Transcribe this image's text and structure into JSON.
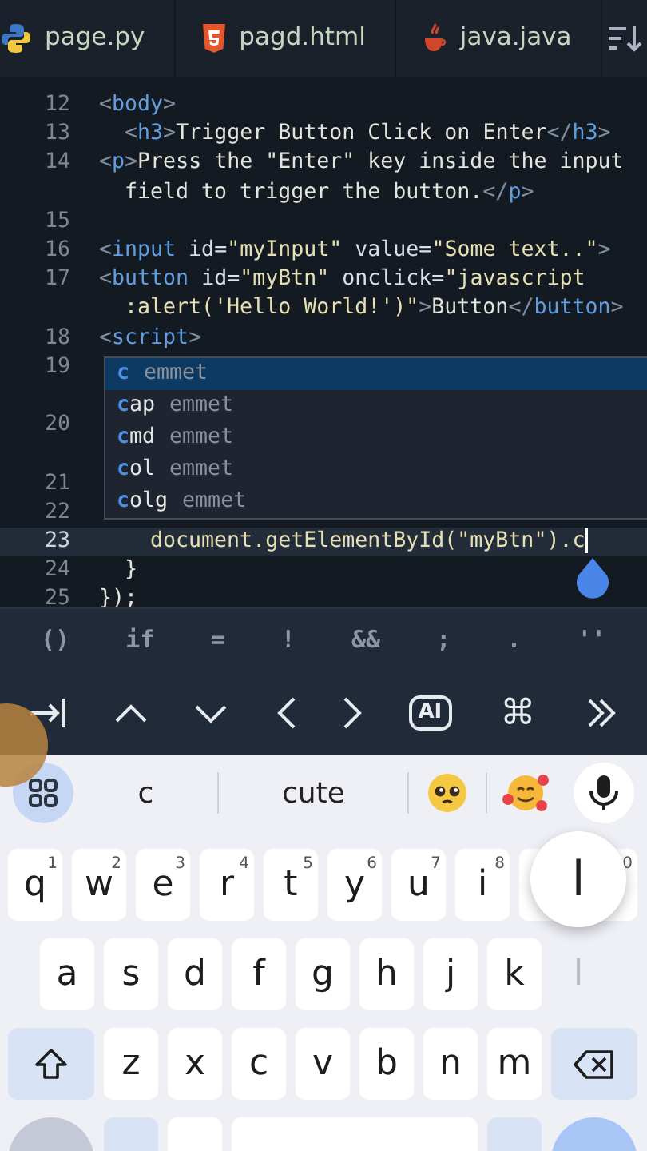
{
  "tabs": [
    {
      "label": "page.py",
      "kind": "python"
    },
    {
      "label": "pagd.html",
      "kind": "html"
    },
    {
      "label": "java.java",
      "kind": "java"
    }
  ],
  "editor": {
    "lines": [
      {
        "kind": "line",
        "number": "12",
        "current": false,
        "segments": [
          {
            "t": "<",
            "kind": "p"
          },
          {
            "t": "body",
            "kind": "tag"
          },
          {
            "t": ">",
            "kind": "p"
          }
        ]
      },
      {
        "kind": "line",
        "number": "13",
        "current": false,
        "segments": [
          {
            "t": "  <",
            "kind": "p"
          },
          {
            "t": "h3",
            "kind": "tag"
          },
          {
            "t": ">",
            "kind": "p"
          },
          {
            "t": "Trigger Button Click on Enter",
            "kind": "text"
          },
          {
            "t": "</",
            "kind": "p"
          },
          {
            "t": "h3",
            "kind": "tag"
          },
          {
            "t": ">",
            "kind": "p"
          }
        ]
      },
      {
        "kind": "line",
        "number": "14",
        "current": false,
        "segments": [
          {
            "t": "<",
            "kind": "p"
          },
          {
            "t": "p",
            "kind": "tag"
          },
          {
            "t": ">",
            "kind": "p"
          },
          {
            "t": "Press the \"Enter\" key inside the input",
            "kind": "text"
          }
        ]
      },
      {
        "kind": "wrap",
        "current": false,
        "segments": [
          {
            "t": "  field to trigger the button.",
            "kind": "text"
          },
          {
            "t": "</",
            "kind": "p"
          },
          {
            "t": "p",
            "kind": "tag"
          },
          {
            "t": ">",
            "kind": "p"
          }
        ]
      },
      {
        "kind": "line",
        "number": "15",
        "current": false
      },
      {
        "kind": "line",
        "number": "16",
        "current": false,
        "segments": [
          {
            "t": "<",
            "kind": "p"
          },
          {
            "t": "input",
            "kind": "tag"
          },
          {
            "t": " id=",
            "kind": "attr"
          },
          {
            "t": "\"myInput\"",
            "kind": "str"
          },
          {
            "t": " value=",
            "kind": "attr"
          },
          {
            "t": "\"Some text..\"",
            "kind": "str"
          },
          {
            "t": ">",
            "kind": "p"
          }
        ]
      },
      {
        "kind": "line",
        "number": "17",
        "current": false,
        "segments": [
          {
            "t": "<",
            "kind": "p"
          },
          {
            "t": "button",
            "kind": "tag"
          },
          {
            "t": " id=",
            "kind": "attr"
          },
          {
            "t": "\"myBtn\"",
            "kind": "str"
          },
          {
            "t": " onclick=",
            "kind": "attr"
          },
          {
            "t": "\"javascript",
            "kind": "str"
          }
        ]
      },
      {
        "kind": "wrap",
        "current": false,
        "segments": [
          {
            "t": "  :alert('Hello World!')\"",
            "kind": "str"
          },
          {
            "t": ">",
            "kind": "p"
          },
          {
            "t": "Button",
            "kind": "text"
          },
          {
            "t": "</",
            "kind": "p"
          },
          {
            "t": "button",
            "kind": "tag"
          },
          {
            "t": ">",
            "kind": "p"
          }
        ]
      },
      {
        "kind": "line",
        "number": "18",
        "current": false,
        "segments": [
          {
            "t": "<",
            "kind": "p"
          },
          {
            "t": "script",
            "kind": "tag"
          },
          {
            "t": ">",
            "kind": "p"
          }
        ]
      },
      {
        "kind": "line",
        "number": "19",
        "current": false
      },
      {
        "kind": "wrap",
        "current": false
      },
      {
        "kind": "line",
        "number": "20",
        "current": false
      },
      {
        "kind": "wrap",
        "current": false
      },
      {
        "kind": "line",
        "number": "21",
        "current": false
      },
      {
        "kind": "line",
        "number": "22",
        "current": false
      },
      {
        "kind": "line",
        "number": "23",
        "current": true,
        "segments": [
          {
            "t": "    document.getElementById(",
            "kind": "str"
          },
          {
            "t": "\"myBtn\"",
            "kind": "str"
          },
          {
            "t": ").c",
            "kind": "str"
          }
        ]
      },
      {
        "kind": "line",
        "number": "24",
        "current": false,
        "segments": [
          {
            "t": "  }",
            "kind": "text"
          }
        ]
      },
      {
        "kind": "line",
        "number": "25",
        "current": false,
        "segments": [
          {
            "t": "});",
            "kind": "text"
          }
        ]
      }
    ],
    "suggestions": [
      {
        "match": "c",
        "detail": "emmet",
        "selected": true
      },
      {
        "match": "c",
        "rest": "ap",
        "detail": "emmet",
        "selected": false
      },
      {
        "match": "c",
        "rest": "md",
        "detail": "emmet",
        "selected": false
      },
      {
        "match": "c",
        "rest": "ol",
        "detail": "emmet",
        "selected": false
      },
      {
        "match": "c",
        "rest": "olg",
        "detail": "emmet",
        "selected": false
      }
    ]
  },
  "symbols": [
    "()",
    "if",
    "=",
    "!",
    "&&",
    ";",
    ".",
    "''"
  ],
  "nav_keys": [
    {
      "kind": "tab"
    },
    {
      "kind": "up"
    },
    {
      "kind": "down"
    },
    {
      "kind": "left"
    },
    {
      "kind": "right"
    },
    {
      "kind": "ai",
      "label": "AI"
    },
    {
      "kind": "cmd",
      "label": "⌘"
    },
    {
      "kind": "more"
    }
  ],
  "keyboard": {
    "suggestions": [
      {
        "kind": "word",
        "label": "c"
      },
      {
        "kind": "word",
        "label": "cute"
      },
      {
        "kind": "emoji-pleading"
      },
      {
        "kind": "emoji-hearts"
      }
    ],
    "preview": "l",
    "rows": [
      [
        {
          "kind": "letter",
          "label": "q",
          "sup": "1"
        },
        {
          "kind": "letter",
          "label": "w",
          "sup": "2"
        },
        {
          "kind": "letter",
          "label": "e",
          "sup": "3"
        },
        {
          "kind": "letter",
          "label": "r",
          "sup": "4"
        },
        {
          "kind": "letter",
          "label": "t",
          "sup": "5"
        },
        {
          "kind": "letter",
          "label": "y",
          "sup": "6"
        },
        {
          "kind": "letter",
          "label": "u",
          "sup": "7"
        },
        {
          "kind": "letter",
          "label": "i",
          "sup": "8"
        },
        {
          "kind": "letter"
        },
        {
          "kind": "letter",
          "sup": "0"
        }
      ],
      [
        {
          "kind": "letter",
          "label": "a"
        },
        {
          "kind": "letter",
          "label": "s"
        },
        {
          "kind": "letter",
          "label": "d"
        },
        {
          "kind": "letter",
          "label": "f"
        },
        {
          "kind": "letter",
          "label": "g"
        },
        {
          "kind": "letter",
          "label": "h"
        },
        {
          "kind": "letter",
          "label": "j"
        },
        {
          "kind": "letter",
          "label": "k"
        },
        {
          "kind": "letter",
          "label": "l",
          "pressed": true
        }
      ],
      [
        {
          "kind": "shift"
        },
        {
          "kind": "letter",
          "label": "z"
        },
        {
          "kind": "letter",
          "label": "x"
        },
        {
          "kind": "letter",
          "label": "c"
        },
        {
          "kind": "letter",
          "label": "v"
        },
        {
          "kind": "letter",
          "label": "b"
        },
        {
          "kind": "letter",
          "label": "n"
        },
        {
          "kind": "letter",
          "label": "m"
        },
        {
          "kind": "backspace"
        }
      ],
      [
        {
          "kind": "mode"
        },
        {
          "kind": "comma"
        },
        {
          "kind": "emoji"
        },
        {
          "kind": "space"
        },
        {
          "kind": "period"
        },
        {
          "kind": "enter"
        }
      ]
    ]
  }
}
